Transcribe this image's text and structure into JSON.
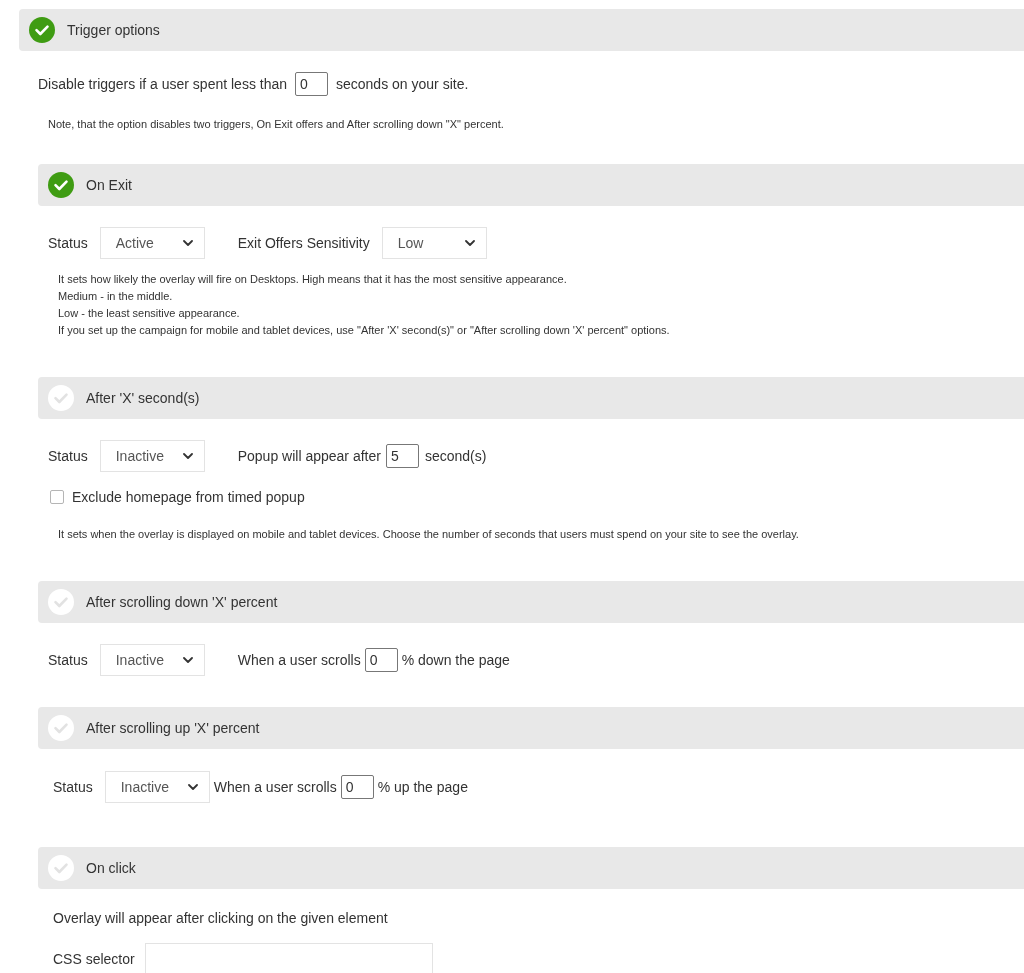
{
  "trigger_options": {
    "title": "Trigger options",
    "enabled": true,
    "disable_row": {
      "text_before": "Disable triggers if a user spent less than",
      "value": "0",
      "text_after": "seconds on your site."
    },
    "note": "Note, that the option disables two triggers, On Exit offers and After scrolling down \"X\" percent.",
    "triggers": [
      {
        "kind": "exit",
        "title": "On Exit",
        "enabled": true,
        "status": {
          "label": "Status",
          "value": "Active"
        },
        "sensitivity": {
          "label": "Exit Offers Sensitivity",
          "value": "Low"
        },
        "help": [
          "It sets how likely the overlay will fire on Desktops. High means that it has the most sensitive appearance.",
          "Medium - in the middle.",
          "Low - the least sensitive appearance.",
          "If you set up the campaign for mobile and tablet devices, use \"After 'X' second(s)\" or \"After scrolling down 'X' percent\" options."
        ]
      },
      {
        "kind": "timed",
        "title": "After 'X' second(s)",
        "enabled": false,
        "status": {
          "label": "Status",
          "value": "Inactive"
        },
        "text_before": "Popup will appear after",
        "value": "5",
        "text_after": "second(s)",
        "checkbox": {
          "label": "Exclude homepage from timed popup",
          "checked": false
        },
        "help": [
          "It sets when the overlay is displayed on mobile and tablet devices. Choose the number of seconds that users must spend on your site to see the overlay."
        ]
      },
      {
        "kind": "scroll",
        "title": "After scrolling down 'X' percent",
        "enabled": false,
        "status": {
          "label": "Status",
          "value": "Inactive"
        },
        "text_before": "When a user scrolls",
        "value": "0",
        "text_after": "% down the page"
      },
      {
        "kind": "compact",
        "title": "After scrolling up 'X' percent",
        "enabled": false,
        "status": {
          "label": "Status",
          "value": "Inactive"
        },
        "text_before": "When a user scrolls",
        "value": "0",
        "text_after": "% up the page"
      },
      {
        "kind": "click",
        "title": "On click",
        "enabled": false,
        "text": "Overlay will appear after clicking on the given element",
        "field_label": "CSS selector"
      }
    ]
  }
}
